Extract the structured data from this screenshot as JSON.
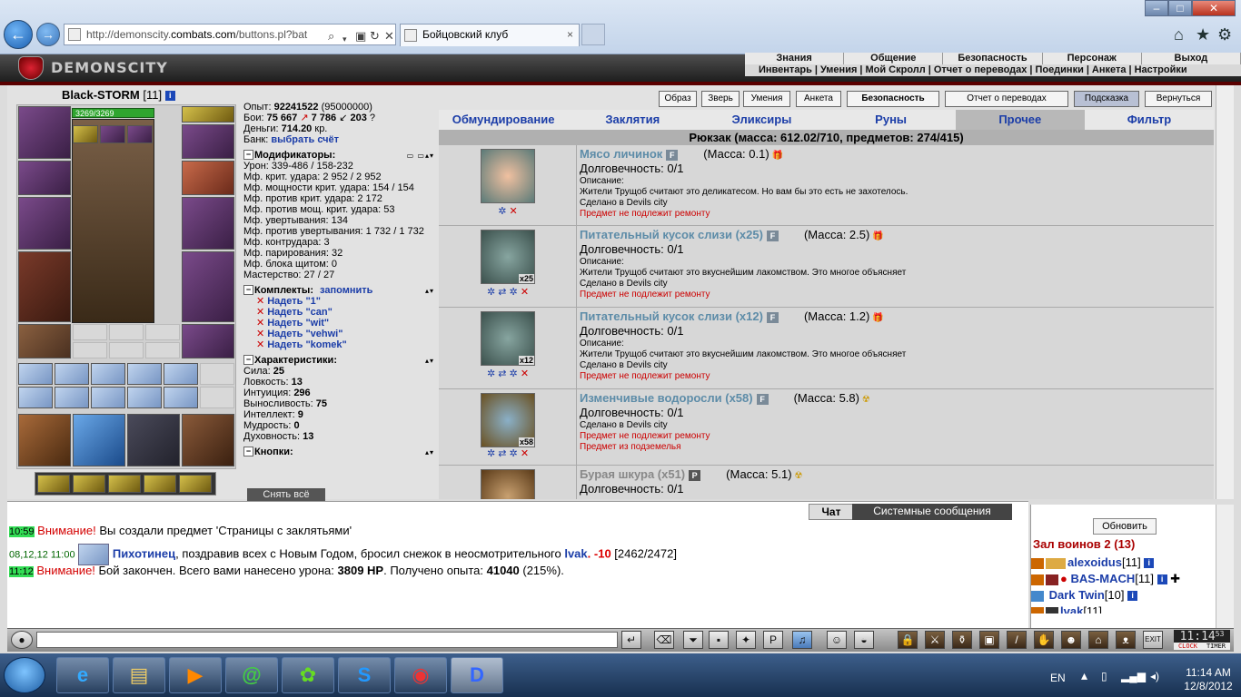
{
  "browser": {
    "url_prefix": "http://demonscity.",
    "url_domain": "combats.com",
    "url_suffix": "/buttons.pl?bat",
    "tab_title": "Бойцовский клуб",
    "tab_close": "×",
    "win_min": "–",
    "win_max": "□",
    "win_close": "✕"
  },
  "game": {
    "logo": "DEMONSCITY",
    "top_menu": [
      "Знания",
      "Общение",
      "Безопасность",
      "Персонаж",
      "Выход"
    ],
    "sub_menu": [
      "Инвентарь",
      "Умения",
      "Мой Скролл",
      "Отчет о переводах",
      "Поединки",
      "Анкета",
      "Настройки"
    ]
  },
  "player": {
    "name": "Black-STORM",
    "level": "[11]",
    "hp": "3269/3269"
  },
  "stats": {
    "exp_label": "Опыт:",
    "exp": "92241522",
    "exp_next": "(95000000)",
    "fights_label": "Бои:",
    "wins": "75 667",
    "losses": "7 786",
    "draws": "203",
    "money_label": "Деньги:",
    "money": "714.20",
    "money_unit": "кр.",
    "bank_label": "Банк:",
    "bank_link": "выбрать счёт",
    "mods_title": "Модификаторы:",
    "mods": [
      "Урон: 339-486 / 158-232",
      "Мф. крит. удара: 2 952 / 2 952",
      "Мф. мощности крит. удара: 154 / 154",
      "Мф. против крит. удара: 2 172",
      "Мф. против мощ. крит. удара: 53",
      "Мф. увертывания: 134",
      "Мф. против увертывания: 1 732 / 1 732",
      "Мф. контрудара: 3",
      "Мф. парирования: 32",
      "Мф. блока щитом: 0",
      "Мастерство: 27 / 27"
    ],
    "sets_title": "Комплекты:",
    "sets_remember": "запомнить",
    "sets": [
      "Надеть \"1\"",
      "Надеть \"can\"",
      "Надеть \"wit\"",
      "Надеть \"vehwi\"",
      "Надеть \"komek\""
    ],
    "chars_title": "Характеристики:",
    "chars": [
      {
        "label": "Сила:",
        "value": "25"
      },
      {
        "label": "Ловкость:",
        "value": "13"
      },
      {
        "label": "Интуиция:",
        "value": "296"
      },
      {
        "label": "Выносливость:",
        "value": "75"
      },
      {
        "label": "Интеллект:",
        "value": "9"
      },
      {
        "label": "Мудрость:",
        "value": "0"
      },
      {
        "label": "Духовность:",
        "value": "13"
      }
    ],
    "buttons_title": "Кнопки:",
    "undress": "Снять всё"
  },
  "top_buttons": [
    "Образ",
    "Зверь",
    "Умения",
    "Анкета",
    "Безопасность",
    "Отчет о переводах",
    "Подсказка",
    "Вернуться"
  ],
  "inv_tabs": [
    "Обмундирование",
    "Заклятия",
    "Эликсиры",
    "Руны",
    "Прочее",
    "Фильтр"
  ],
  "backpack_header": "Рюкзак (масса: 612.02/710, предметов: 274/415)",
  "items": [
    {
      "name": "Мясо личинок",
      "tag": "F",
      "mass": "(Масса: 0.1)",
      "qty": "",
      "dur": "Долговечность: 0/1",
      "desc_label": "Описание:",
      "desc": "Жители Трущоб считают это деликатесом. Но вам бы это есть не захотелось.",
      "made": "Сделано в Devils city",
      "warn1": "Предмет не подлежит ремонту",
      "warn2": ""
    },
    {
      "name": "Питательный кусок слизи (x25)",
      "tag": "F",
      "mass": "(Масса: 2.5)",
      "qty": "x25",
      "dur": "Долговечность: 0/1",
      "desc_label": "Описание:",
      "desc": "Жители Трущоб считают это вкуснейшим лакомством. Это многое объясняет",
      "made": "Сделано в Devils city",
      "warn1": "Предмет не подлежит ремонту",
      "warn2": ""
    },
    {
      "name": "Питательный кусок слизи (x12)",
      "tag": "F",
      "mass": "(Масса: 1.2)",
      "qty": "x12",
      "dur": "Долговечность: 0/1",
      "desc_label": "Описание:",
      "desc": "Жители Трущоб считают это вкуснейшим лакомством. Это многое объясняет",
      "made": "Сделано в Devils city",
      "warn1": "Предмет не подлежит ремонту",
      "warn2": ""
    },
    {
      "name": "Изменчивые водоросли (x58)",
      "tag": "F",
      "mass": "(Масса: 5.8)",
      "qty": "x58",
      "dur": "Долговечность: 0/1",
      "desc_label": "",
      "desc": "",
      "made": "Сделано в Devils city",
      "warn1": "Предмет не подлежит ремонту",
      "warn2": "Предмет из подземелья"
    },
    {
      "name": "Бурая шкура (x51)",
      "tag": "P",
      "mass": "(Масса: 5.1)",
      "qty": "",
      "dur": "Долговечность: 0/1",
      "desc_label": "",
      "desc": "",
      "made": "",
      "warn1": "",
      "warn2": ""
    }
  ],
  "chat": {
    "tab_chat": "Чат",
    "tab_system": "Системные сообщения",
    "lines": {
      "l1_time": "10:59",
      "l1_warn": "Внимание!",
      "l1_text": " Вы создали предмет 'Страницы с заклятьями'",
      "l2_time": "08,12,12 11:00",
      "l2_name": "Пихотинец",
      "l2_text": ", поздравив всех с Новым Годом, бросил снежок в неосмотрительного ",
      "l2_target": "lvak",
      "l2_dmg": ". -10",
      "l2_hp": " [2462/2472]",
      "l3_time": "11:12",
      "l3_warn": "Внимание!",
      "l3_text": " Бой закончен. Всего вами нанесено урона: ",
      "l3_dmg": "3809 HP",
      "l3_text2": ". Получено опыта: ",
      "l3_exp": "41040",
      "l3_pct": " (215%)."
    }
  },
  "room": {
    "refresh": "Обновить",
    "title": "Зал воинов 2 (13)",
    "users": [
      {
        "name": "alexoidus",
        "level": "[11]"
      },
      {
        "name": "BAS-MACH",
        "level": "[11]"
      },
      {
        "name": "Dark Twin",
        "level": "[10]"
      },
      {
        "name": "lvak",
        "level": "[11]"
      }
    ]
  },
  "clock": {
    "time": "11:14",
    "sec": "53",
    "lbl1": "CLOCK",
    "lbl2": "TIMER"
  },
  "taskbar": {
    "lang": "EN",
    "time": "11:14 AM",
    "date": "12/8/2012"
  }
}
